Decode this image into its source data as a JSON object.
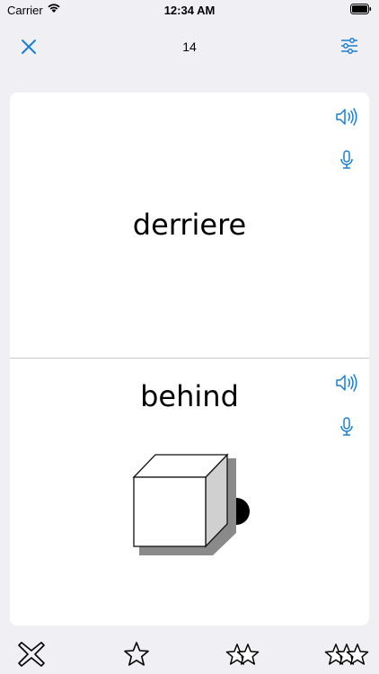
{
  "status_bar": {
    "carrier": "Carrier",
    "time": "12:34 AM",
    "wifi_icon": "wifi-icon",
    "battery_icon": "battery-icon"
  },
  "nav": {
    "close_icon": "close-icon",
    "counter": "14",
    "settings_icon": "sliders-icon",
    "accent_color": "#1a7fd4"
  },
  "card": {
    "front": {
      "word": "derriere",
      "speaker_icon": "speaker-icon",
      "mic_icon": "microphone-icon"
    },
    "back": {
      "word": "behind",
      "speaker_icon": "speaker-icon",
      "mic_icon": "microphone-icon",
      "illustration": "cube-with-ball-behind"
    }
  },
  "rating_bar": {
    "items": [
      {
        "icon": "x-outline-icon"
      },
      {
        "icon": "one-star-icon"
      },
      {
        "icon": "two-stars-icon"
      },
      {
        "icon": "three-stars-icon"
      }
    ]
  }
}
